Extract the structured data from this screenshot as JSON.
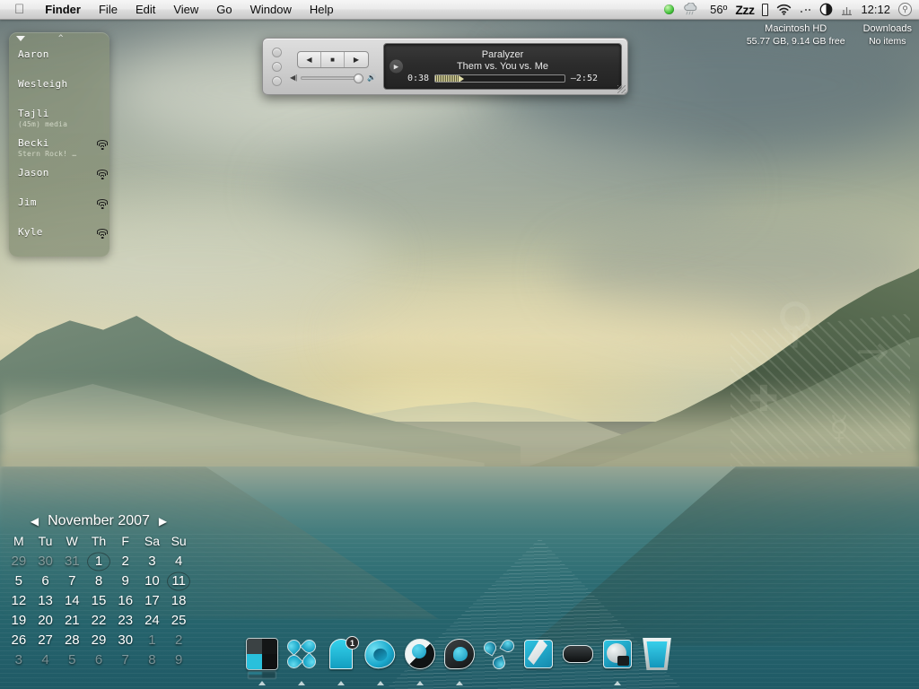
{
  "menubar": {
    "apple_icon": "apple-logo-icon",
    "items": [
      {
        "label": "Finder",
        "bold": true
      },
      {
        "label": "File",
        "bold": false
      },
      {
        "label": "Edit",
        "bold": false
      },
      {
        "label": "View",
        "bold": false
      },
      {
        "label": "Go",
        "bold": false
      },
      {
        "label": "Window",
        "bold": false
      },
      {
        "label": "Help",
        "bold": false
      }
    ],
    "status": {
      "online_dot": "green-status-dot-icon",
      "weather_icon": "rain-cloud-icon",
      "temperature": "56º",
      "caffeine": "Zzz",
      "battery_icon": "battery-icon",
      "wifi_icon": "wifi-icon",
      "dots_icon": "bluetooth-dots-icon",
      "display_icon": "display-brightness-icon",
      "meter_icon": "signal-meter-icon",
      "clock": "12:12",
      "spotlight_icon": "search-icon"
    }
  },
  "desktop_icons": [
    {
      "name": "Macintosh HD",
      "sub": "55.77 GB, 9.14 GB free"
    },
    {
      "name": "Downloads",
      "sub": "No items"
    }
  ],
  "buddylist": {
    "collapse_icon": "triangle-down-icon",
    "caret_icon": "caret-up-icon",
    "buddies": [
      {
        "name": "Aaron",
        "status": "",
        "icon": "blue-ball-icon"
      },
      {
        "name": "Wesleigh",
        "status": "",
        "icon": "blue-ball-icon"
      },
      {
        "name": "Tajli",
        "status": "(45m) media",
        "icon": "blue-ball-dim-icon"
      },
      {
        "name": "Becki",
        "status": "Stern Rock! …",
        "icon": "wifi-icon"
      },
      {
        "name": "Jason",
        "status": "",
        "icon": "wifi-icon"
      },
      {
        "name": "Jim",
        "status": "",
        "icon": "wifi-icon"
      },
      {
        "name": "Kyle",
        "status": "",
        "icon": "wifi-icon"
      }
    ]
  },
  "player": {
    "window_buttons": [
      "close-button",
      "minimize-button",
      "zoom-button"
    ],
    "prev_label": "◀",
    "stop_label": "■",
    "next_label": "▶",
    "volume_low_icon": "speaker-low-icon",
    "volume_high_icon": "speaker-high-icon",
    "volume_percent": 92,
    "play_state_icon": "play-icon",
    "track_title": "Paralyzer",
    "track_artist": "Them vs. You vs. Me",
    "elapsed": "0:38",
    "remaining": "–2:52",
    "progress_percent": 18,
    "resize_grip": "resize-grip-icon"
  },
  "calendar": {
    "prev_icon": "◀",
    "next_icon": "▶",
    "title": "November 2007",
    "dow": [
      "M",
      "Tu",
      "W",
      "Th",
      "F",
      "Sa",
      "Su"
    ],
    "weeks": [
      [
        {
          "n": "29",
          "out": true
        },
        {
          "n": "30",
          "out": true
        },
        {
          "n": "31",
          "out": true
        },
        {
          "n": "1",
          "circ": true
        },
        {
          "n": "2"
        },
        {
          "n": "3"
        },
        {
          "n": "4"
        }
      ],
      [
        {
          "n": "5"
        },
        {
          "n": "6"
        },
        {
          "n": "7"
        },
        {
          "n": "8"
        },
        {
          "n": "9"
        },
        {
          "n": "10"
        },
        {
          "n": "11",
          "circ": true
        }
      ],
      [
        {
          "n": "12"
        },
        {
          "n": "13"
        },
        {
          "n": "14"
        },
        {
          "n": "15"
        },
        {
          "n": "16"
        },
        {
          "n": "17"
        },
        {
          "n": "18"
        }
      ],
      [
        {
          "n": "19"
        },
        {
          "n": "20"
        },
        {
          "n": "21"
        },
        {
          "n": "22"
        },
        {
          "n": "23"
        },
        {
          "n": "24"
        },
        {
          "n": "25"
        }
      ],
      [
        {
          "n": "26"
        },
        {
          "n": "27"
        },
        {
          "n": "28"
        },
        {
          "n": "29"
        },
        {
          "n": "30"
        },
        {
          "n": "1",
          "out": true
        },
        {
          "n": "2",
          "out": true
        }
      ],
      [
        {
          "n": "3",
          "out": true
        },
        {
          "n": "4",
          "out": true
        },
        {
          "n": "5",
          "out": true
        },
        {
          "n": "6",
          "out": true
        },
        {
          "n": "7",
          "out": true
        },
        {
          "n": "8",
          "out": true
        },
        {
          "n": "9",
          "out": true
        }
      ]
    ]
  },
  "dock": {
    "items": [
      {
        "name": "Finder",
        "icon": "finder-icon",
        "running": true,
        "badge": ""
      },
      {
        "name": "Spaces",
        "icon": "clover-icon",
        "running": true,
        "badge": ""
      },
      {
        "name": "Mail",
        "icon": "mail-icon",
        "running": true,
        "badge": "1"
      },
      {
        "name": "Safari",
        "icon": "safari-icon",
        "running": true,
        "badge": ""
      },
      {
        "name": "Adium",
        "icon": "yin-yang-icon",
        "running": true,
        "badge": ""
      },
      {
        "name": "Quicksilver",
        "icon": "quicksilver-icon",
        "running": true,
        "badge": ""
      },
      {
        "name": "Transmission",
        "icon": "tri-leaf-icon",
        "running": false,
        "badge": ""
      },
      {
        "name": "TextEdit",
        "icon": "quill-icon",
        "running": false,
        "badge": ""
      },
      {
        "name": "Terminal",
        "icon": "pill-icon",
        "running": false,
        "badge": ""
      },
      {
        "name": "Disk Utility",
        "icon": "disk-icon",
        "running": true,
        "badge": ""
      },
      {
        "name": "Trash",
        "icon": "trash-icon",
        "running": false,
        "badge": ""
      }
    ]
  },
  "wallpaper": {
    "description": "Misty lake between mountains at dawn",
    "sky_color": "#8e9a8c",
    "glow_color": "#f5e8aa",
    "water_color": "#2f6e74",
    "mountain_color": "#51685c"
  }
}
